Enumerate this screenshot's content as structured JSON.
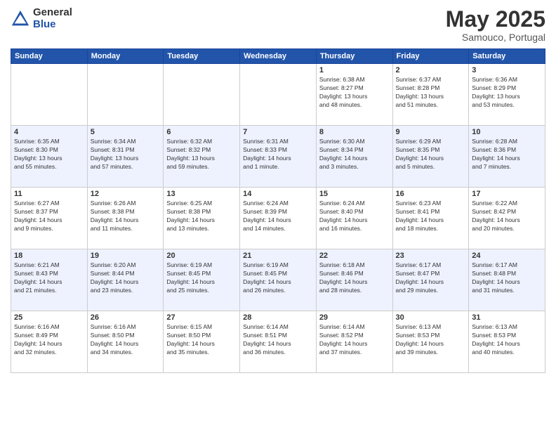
{
  "header": {
    "logo_general": "General",
    "logo_blue": "Blue",
    "month_year": "May 2025",
    "location": "Samouco, Portugal"
  },
  "weekdays": [
    "Sunday",
    "Monday",
    "Tuesday",
    "Wednesday",
    "Thursday",
    "Friday",
    "Saturday"
  ],
  "weeks": [
    [
      {
        "day": "",
        "info": ""
      },
      {
        "day": "",
        "info": ""
      },
      {
        "day": "",
        "info": ""
      },
      {
        "day": "",
        "info": ""
      },
      {
        "day": "1",
        "info": "Sunrise: 6:38 AM\nSunset: 8:27 PM\nDaylight: 13 hours\nand 48 minutes."
      },
      {
        "day": "2",
        "info": "Sunrise: 6:37 AM\nSunset: 8:28 PM\nDaylight: 13 hours\nand 51 minutes."
      },
      {
        "day": "3",
        "info": "Sunrise: 6:36 AM\nSunset: 8:29 PM\nDaylight: 13 hours\nand 53 minutes."
      }
    ],
    [
      {
        "day": "4",
        "info": "Sunrise: 6:35 AM\nSunset: 8:30 PM\nDaylight: 13 hours\nand 55 minutes."
      },
      {
        "day": "5",
        "info": "Sunrise: 6:34 AM\nSunset: 8:31 PM\nDaylight: 13 hours\nand 57 minutes."
      },
      {
        "day": "6",
        "info": "Sunrise: 6:32 AM\nSunset: 8:32 PM\nDaylight: 13 hours\nand 59 minutes."
      },
      {
        "day": "7",
        "info": "Sunrise: 6:31 AM\nSunset: 8:33 PM\nDaylight: 14 hours\nand 1 minute."
      },
      {
        "day": "8",
        "info": "Sunrise: 6:30 AM\nSunset: 8:34 PM\nDaylight: 14 hours\nand 3 minutes."
      },
      {
        "day": "9",
        "info": "Sunrise: 6:29 AM\nSunset: 8:35 PM\nDaylight: 14 hours\nand 5 minutes."
      },
      {
        "day": "10",
        "info": "Sunrise: 6:28 AM\nSunset: 8:36 PM\nDaylight: 14 hours\nand 7 minutes."
      }
    ],
    [
      {
        "day": "11",
        "info": "Sunrise: 6:27 AM\nSunset: 8:37 PM\nDaylight: 14 hours\nand 9 minutes."
      },
      {
        "day": "12",
        "info": "Sunrise: 6:26 AM\nSunset: 8:38 PM\nDaylight: 14 hours\nand 11 minutes."
      },
      {
        "day": "13",
        "info": "Sunrise: 6:25 AM\nSunset: 8:38 PM\nDaylight: 14 hours\nand 13 minutes."
      },
      {
        "day": "14",
        "info": "Sunrise: 6:24 AM\nSunset: 8:39 PM\nDaylight: 14 hours\nand 14 minutes."
      },
      {
        "day": "15",
        "info": "Sunrise: 6:24 AM\nSunset: 8:40 PM\nDaylight: 14 hours\nand 16 minutes."
      },
      {
        "day": "16",
        "info": "Sunrise: 6:23 AM\nSunset: 8:41 PM\nDaylight: 14 hours\nand 18 minutes."
      },
      {
        "day": "17",
        "info": "Sunrise: 6:22 AM\nSunset: 8:42 PM\nDaylight: 14 hours\nand 20 minutes."
      }
    ],
    [
      {
        "day": "18",
        "info": "Sunrise: 6:21 AM\nSunset: 8:43 PM\nDaylight: 14 hours\nand 21 minutes."
      },
      {
        "day": "19",
        "info": "Sunrise: 6:20 AM\nSunset: 8:44 PM\nDaylight: 14 hours\nand 23 minutes."
      },
      {
        "day": "20",
        "info": "Sunrise: 6:19 AM\nSunset: 8:45 PM\nDaylight: 14 hours\nand 25 minutes."
      },
      {
        "day": "21",
        "info": "Sunrise: 6:19 AM\nSunset: 8:45 PM\nDaylight: 14 hours\nand 26 minutes."
      },
      {
        "day": "22",
        "info": "Sunrise: 6:18 AM\nSunset: 8:46 PM\nDaylight: 14 hours\nand 28 minutes."
      },
      {
        "day": "23",
        "info": "Sunrise: 6:17 AM\nSunset: 8:47 PM\nDaylight: 14 hours\nand 29 minutes."
      },
      {
        "day": "24",
        "info": "Sunrise: 6:17 AM\nSunset: 8:48 PM\nDaylight: 14 hours\nand 31 minutes."
      }
    ],
    [
      {
        "day": "25",
        "info": "Sunrise: 6:16 AM\nSunset: 8:49 PM\nDaylight: 14 hours\nand 32 minutes."
      },
      {
        "day": "26",
        "info": "Sunrise: 6:16 AM\nSunset: 8:50 PM\nDaylight: 14 hours\nand 34 minutes."
      },
      {
        "day": "27",
        "info": "Sunrise: 6:15 AM\nSunset: 8:50 PM\nDaylight: 14 hours\nand 35 minutes."
      },
      {
        "day": "28",
        "info": "Sunrise: 6:14 AM\nSunset: 8:51 PM\nDaylight: 14 hours\nand 36 minutes."
      },
      {
        "day": "29",
        "info": "Sunrise: 6:14 AM\nSunset: 8:52 PM\nDaylight: 14 hours\nand 37 minutes."
      },
      {
        "day": "30",
        "info": "Sunrise: 6:13 AM\nSunset: 8:53 PM\nDaylight: 14 hours\nand 39 minutes."
      },
      {
        "day": "31",
        "info": "Sunrise: 6:13 AM\nSunset: 8:53 PM\nDaylight: 14 hours\nand 40 minutes."
      }
    ]
  ]
}
